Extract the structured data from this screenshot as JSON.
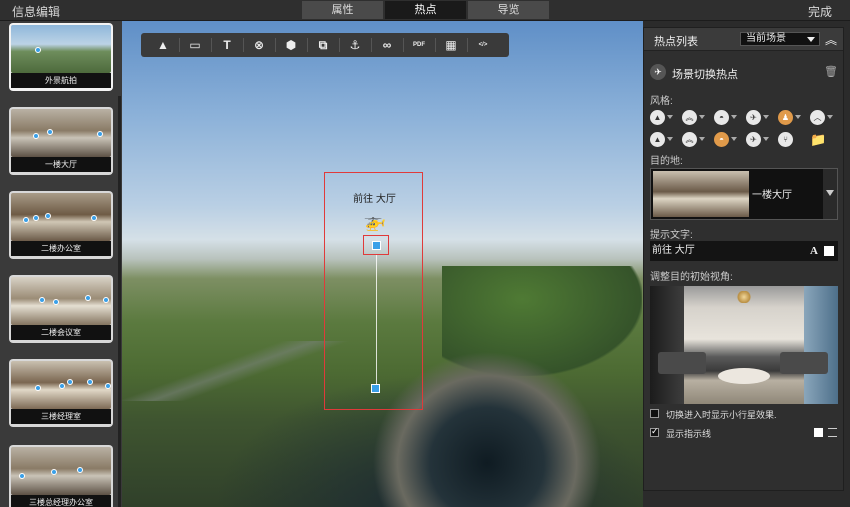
{
  "app": {
    "title": "信息编辑",
    "done_label": "完成"
  },
  "tabs": [
    {
      "label": "属性"
    },
    {
      "label": "热点"
    },
    {
      "label": "导览"
    }
  ],
  "scenes": [
    {
      "label": "外景航拍"
    },
    {
      "label": "一楼大厅"
    },
    {
      "label": "二楼办公室"
    },
    {
      "label": "二楼会议室"
    },
    {
      "label": "三楼经理室"
    },
    {
      "label": "三楼总经理办公室"
    }
  ],
  "toolbar": {
    "buttons": [
      {
        "icon": "tree-icon",
        "glyph": "▲"
      },
      {
        "icon": "image-icon",
        "glyph": "▭"
      },
      {
        "icon": "text-icon",
        "glyph": "T"
      },
      {
        "icon": "target-icon",
        "glyph": "⊗"
      },
      {
        "icon": "cube-icon",
        "glyph": "⬢"
      },
      {
        "icon": "layers-icon",
        "glyph": "⧉"
      },
      {
        "icon": "anchor-icon",
        "glyph": "⚓"
      },
      {
        "icon": "link-icon",
        "glyph": "∞"
      },
      {
        "icon": "pdf-icon",
        "glyph": "PDF"
      },
      {
        "icon": "grid-icon",
        "glyph": "▦"
      },
      {
        "icon": "code-icon",
        "glyph": "</>"
      }
    ]
  },
  "hotspot": {
    "text": "前往 大厅",
    "icon": "helicopter-icon"
  },
  "panel": {
    "title": "热点列表",
    "filter_value": "当前场景",
    "section_title": "场景切换热点",
    "style_label": "风格:",
    "destination_label": "目的地:",
    "destination_value": "一楼大厅",
    "tip_label": "提示文字:",
    "tip_value": "前往 大厅",
    "font_glyph": "A",
    "view_label": "调整目的初始视角:",
    "checkbox_planet": "切换进入时显示小行星效果.",
    "checkbox_guideline": "显示指示线",
    "guideline_checked": true,
    "planet_checked": false
  }
}
